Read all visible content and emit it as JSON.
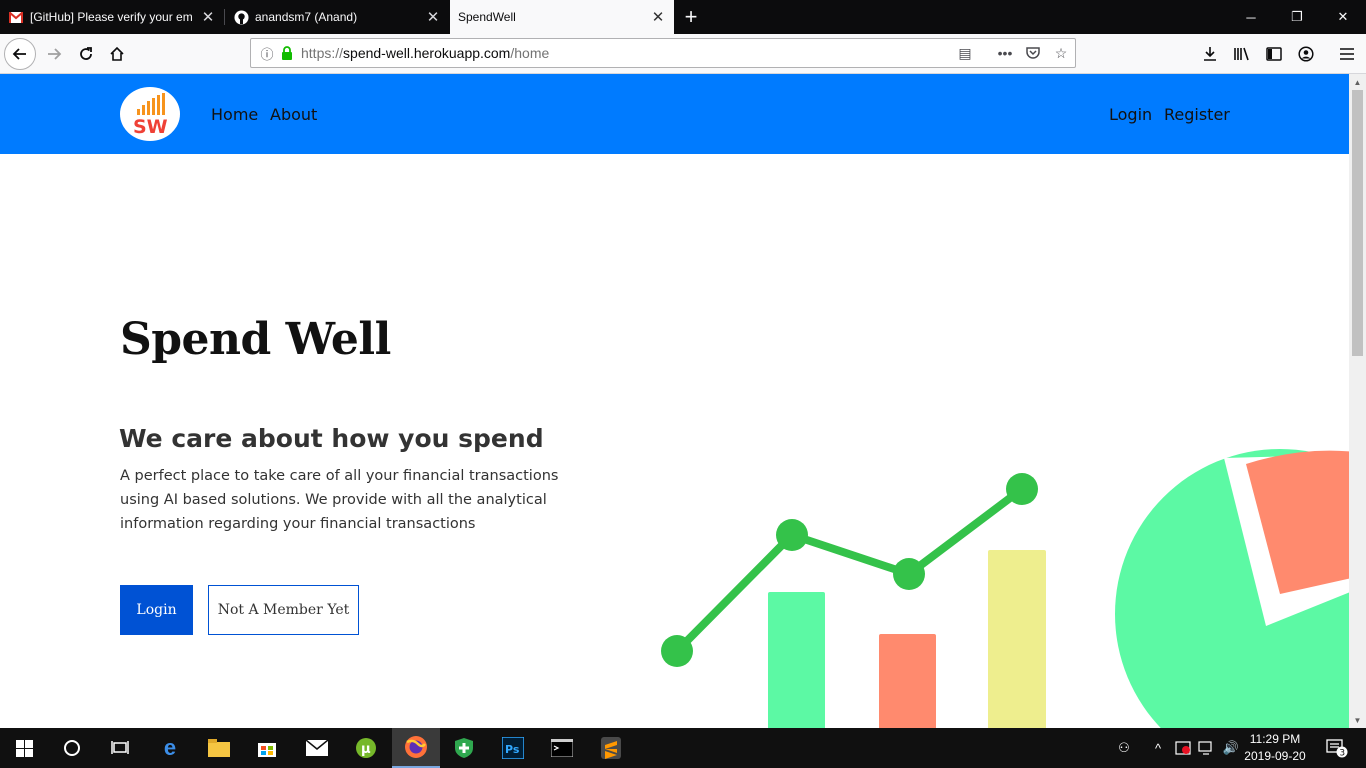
{
  "browser": {
    "tabs": [
      {
        "title": "[GitHub] Please verify your em",
        "icon": "gmail-icon"
      },
      {
        "title": "anandsm7 (Anand)",
        "icon": "github-icon"
      },
      {
        "title": "SpendWell",
        "icon": ""
      }
    ],
    "url": {
      "scheme": "https://",
      "host": "spend-well.herokuapp.com",
      "path": "/home"
    }
  },
  "site": {
    "logo_text": "SW",
    "nav_left": [
      "Home",
      "About"
    ],
    "nav_right": [
      "Login",
      "Register"
    ],
    "colors": {
      "header": "#007bff",
      "primary_button": "#0052d4",
      "line": "#34c24a",
      "bar_green": "#5cf9a4",
      "bar_red": "#ff8a6e",
      "bar_yellow": "#eeee8e"
    }
  },
  "hero": {
    "title": "Spend Well",
    "subtitle": "We care about how you spend",
    "description": "A perfect place to take care of all your financial transactions using AI based solutions. We provide with all the analytical information regarding your financial transactions",
    "buttons": {
      "login": "Login",
      "member": "Not A Member Yet"
    }
  },
  "taskbar": {
    "time": "11:29 PM",
    "date": "2019-09-20",
    "notification_count": "3"
  }
}
